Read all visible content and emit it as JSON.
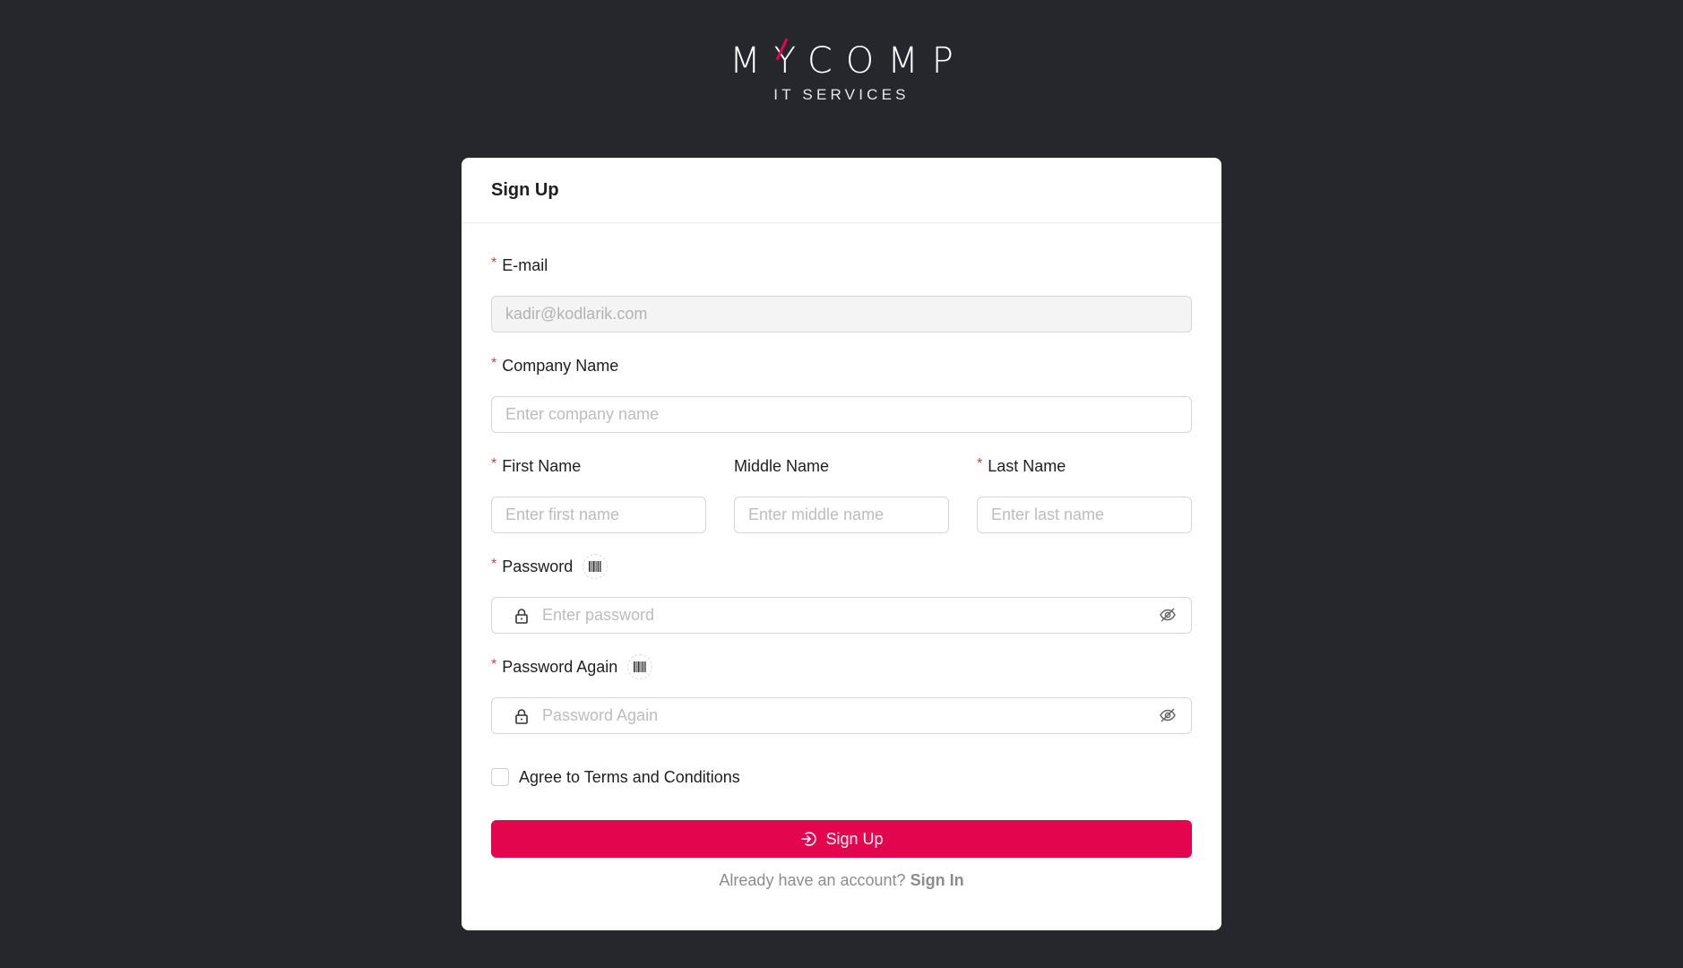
{
  "logo": {
    "brand": "MYCOMP",
    "tagline": "IT SERVICES",
    "accent_color": "#e3064f"
  },
  "form": {
    "title": "Sign Up",
    "email": {
      "label": "E-mail",
      "required": true,
      "value": "kadir@kodlarik.com",
      "disabled": true
    },
    "company": {
      "label": "Company Name",
      "required": true,
      "placeholder": "Enter company name"
    },
    "first_name": {
      "label": "First Name",
      "required": true,
      "placeholder": "Enter first name"
    },
    "middle_name": {
      "label": "Middle Name",
      "required": false,
      "placeholder": "Enter middle name"
    },
    "last_name": {
      "label": "Last Name",
      "required": true,
      "placeholder": "Enter last name"
    },
    "password": {
      "label": "Password",
      "required": true,
      "placeholder": "Enter password",
      "prefix_icon": "lock-icon",
      "suffix_icon": "eye-off-icon",
      "label_icon": "barcode-icon"
    },
    "password_again": {
      "label": "Password Again",
      "required": true,
      "placeholder": "Password Again",
      "prefix_icon": "lock-icon",
      "suffix_icon": "eye-off-icon",
      "label_icon": "barcode-icon"
    },
    "terms": {
      "label": "Agree to Terms and Conditions",
      "checked": false
    },
    "submit": {
      "label": "Sign Up",
      "icon": "login-icon",
      "color": "#e3064f"
    },
    "footer": {
      "prompt": "Already have an account?",
      "link": "Sign In"
    }
  }
}
